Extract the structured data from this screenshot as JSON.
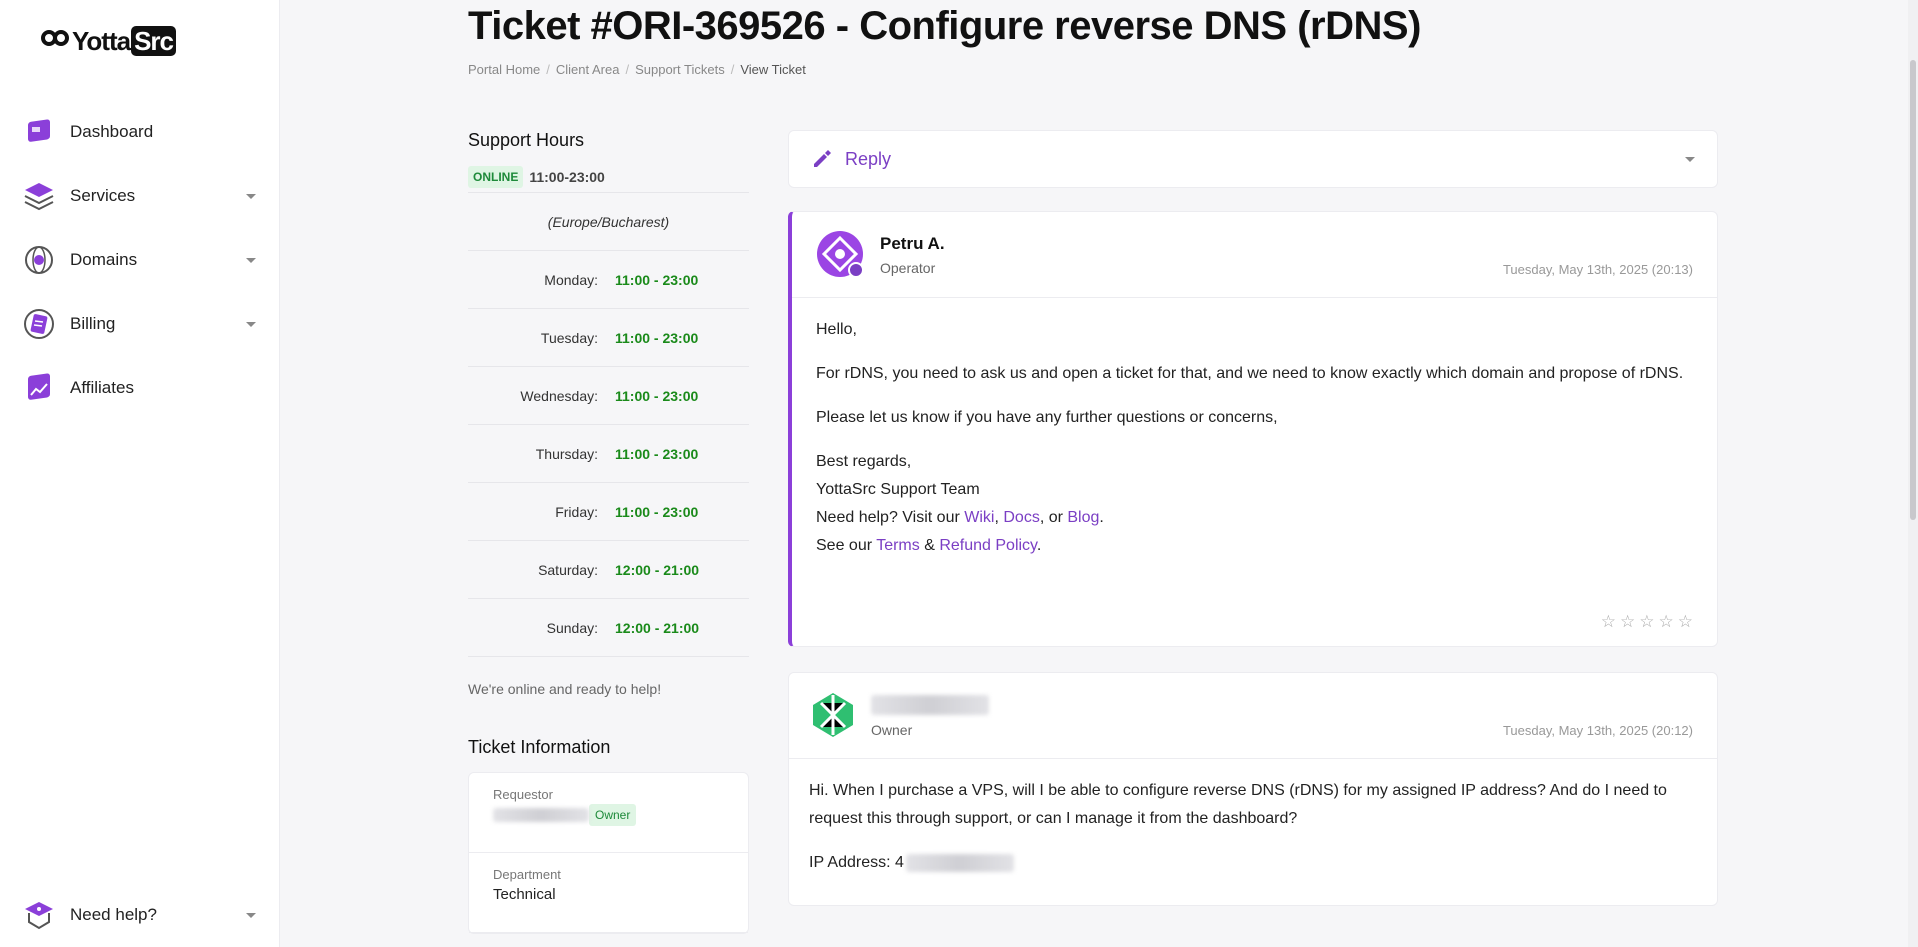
{
  "brand": {
    "logo_text": "Yotta",
    "logo_src": "Src",
    "accent": "#8b3fd9"
  },
  "sidebar": {
    "items": [
      {
        "label": "Dashboard",
        "icon": "dashboard-icon",
        "has_caret": false
      },
      {
        "label": "Services",
        "icon": "services-icon",
        "has_caret": true
      },
      {
        "label": "Domains",
        "icon": "domains-icon",
        "has_caret": true
      },
      {
        "label": "Billing",
        "icon": "billing-icon",
        "has_caret": true
      },
      {
        "label": "Affiliates",
        "icon": "affiliates-icon",
        "has_caret": false
      }
    ],
    "help": {
      "label": "Need help?",
      "icon": "help-icon"
    }
  },
  "page": {
    "title": "Ticket #ORI-369526 - Configure reverse DNS (rDNS)",
    "breadcrumb": [
      "Portal Home",
      "Client Area",
      "Support Tickets",
      "View Ticket"
    ]
  },
  "support_hours": {
    "title": "Support Hours",
    "status": "ONLINE",
    "status_time": "11:00-23:00",
    "timezone": "(Europe/Bucharest)",
    "days": [
      {
        "day": "Monday:",
        "time": "11:00 - 23:00"
      },
      {
        "day": "Tuesday:",
        "time": "11:00 - 23:00"
      },
      {
        "day": "Wednesday:",
        "time": "11:00 - 23:00"
      },
      {
        "day": "Thursday:",
        "time": "11:00 - 23:00"
      },
      {
        "day": "Friday:",
        "time": "11:00 - 23:00"
      },
      {
        "day": "Saturday:",
        "time": "12:00 - 21:00"
      },
      {
        "day": "Sunday:",
        "time": "12:00 - 21:00"
      }
    ],
    "message": "We're online and ready to help!"
  },
  "ticket_info": {
    "title": "Ticket Information",
    "requestor_label": "Requestor",
    "requestor_badge": "Owner",
    "department_label": "Department",
    "department_value": "Technical"
  },
  "reply": {
    "label": "Reply"
  },
  "messages": {
    "operator": {
      "name": "Petru A.",
      "role": "Operator",
      "timestamp": "Tuesday, May 13th, 2025 (20:13)",
      "greeting": "Hello,",
      "p1": "For rDNS, you need to ask us and open a ticket for that, and we need to know exactly which domain and propose of rDNS.",
      "p2": "Please let us know if you have any further questions or concerns,",
      "sign1": "Best regards,",
      "sign2": "YottaSrc Support Team",
      "help_prefix": "Need help? Visit our ",
      "wiki": "Wiki",
      "comma": ", ",
      "docs": "Docs",
      "or": ", or ",
      "blog": "Blog",
      "dot": ".",
      "see_prefix": "See our ",
      "terms": "Terms",
      "amp": " & ",
      "refund": "Refund Policy",
      "dot2": "."
    },
    "client": {
      "role": "Owner",
      "timestamp": "Tuesday, May 13th, 2025 (20:12)",
      "body": "Hi. When I purchase a VPS, will I be able to configure reverse DNS (rDNS) for my assigned IP address? And do I need to request this through support, or can I manage it from the dashboard?",
      "ip_label": "IP Address: 4"
    }
  }
}
